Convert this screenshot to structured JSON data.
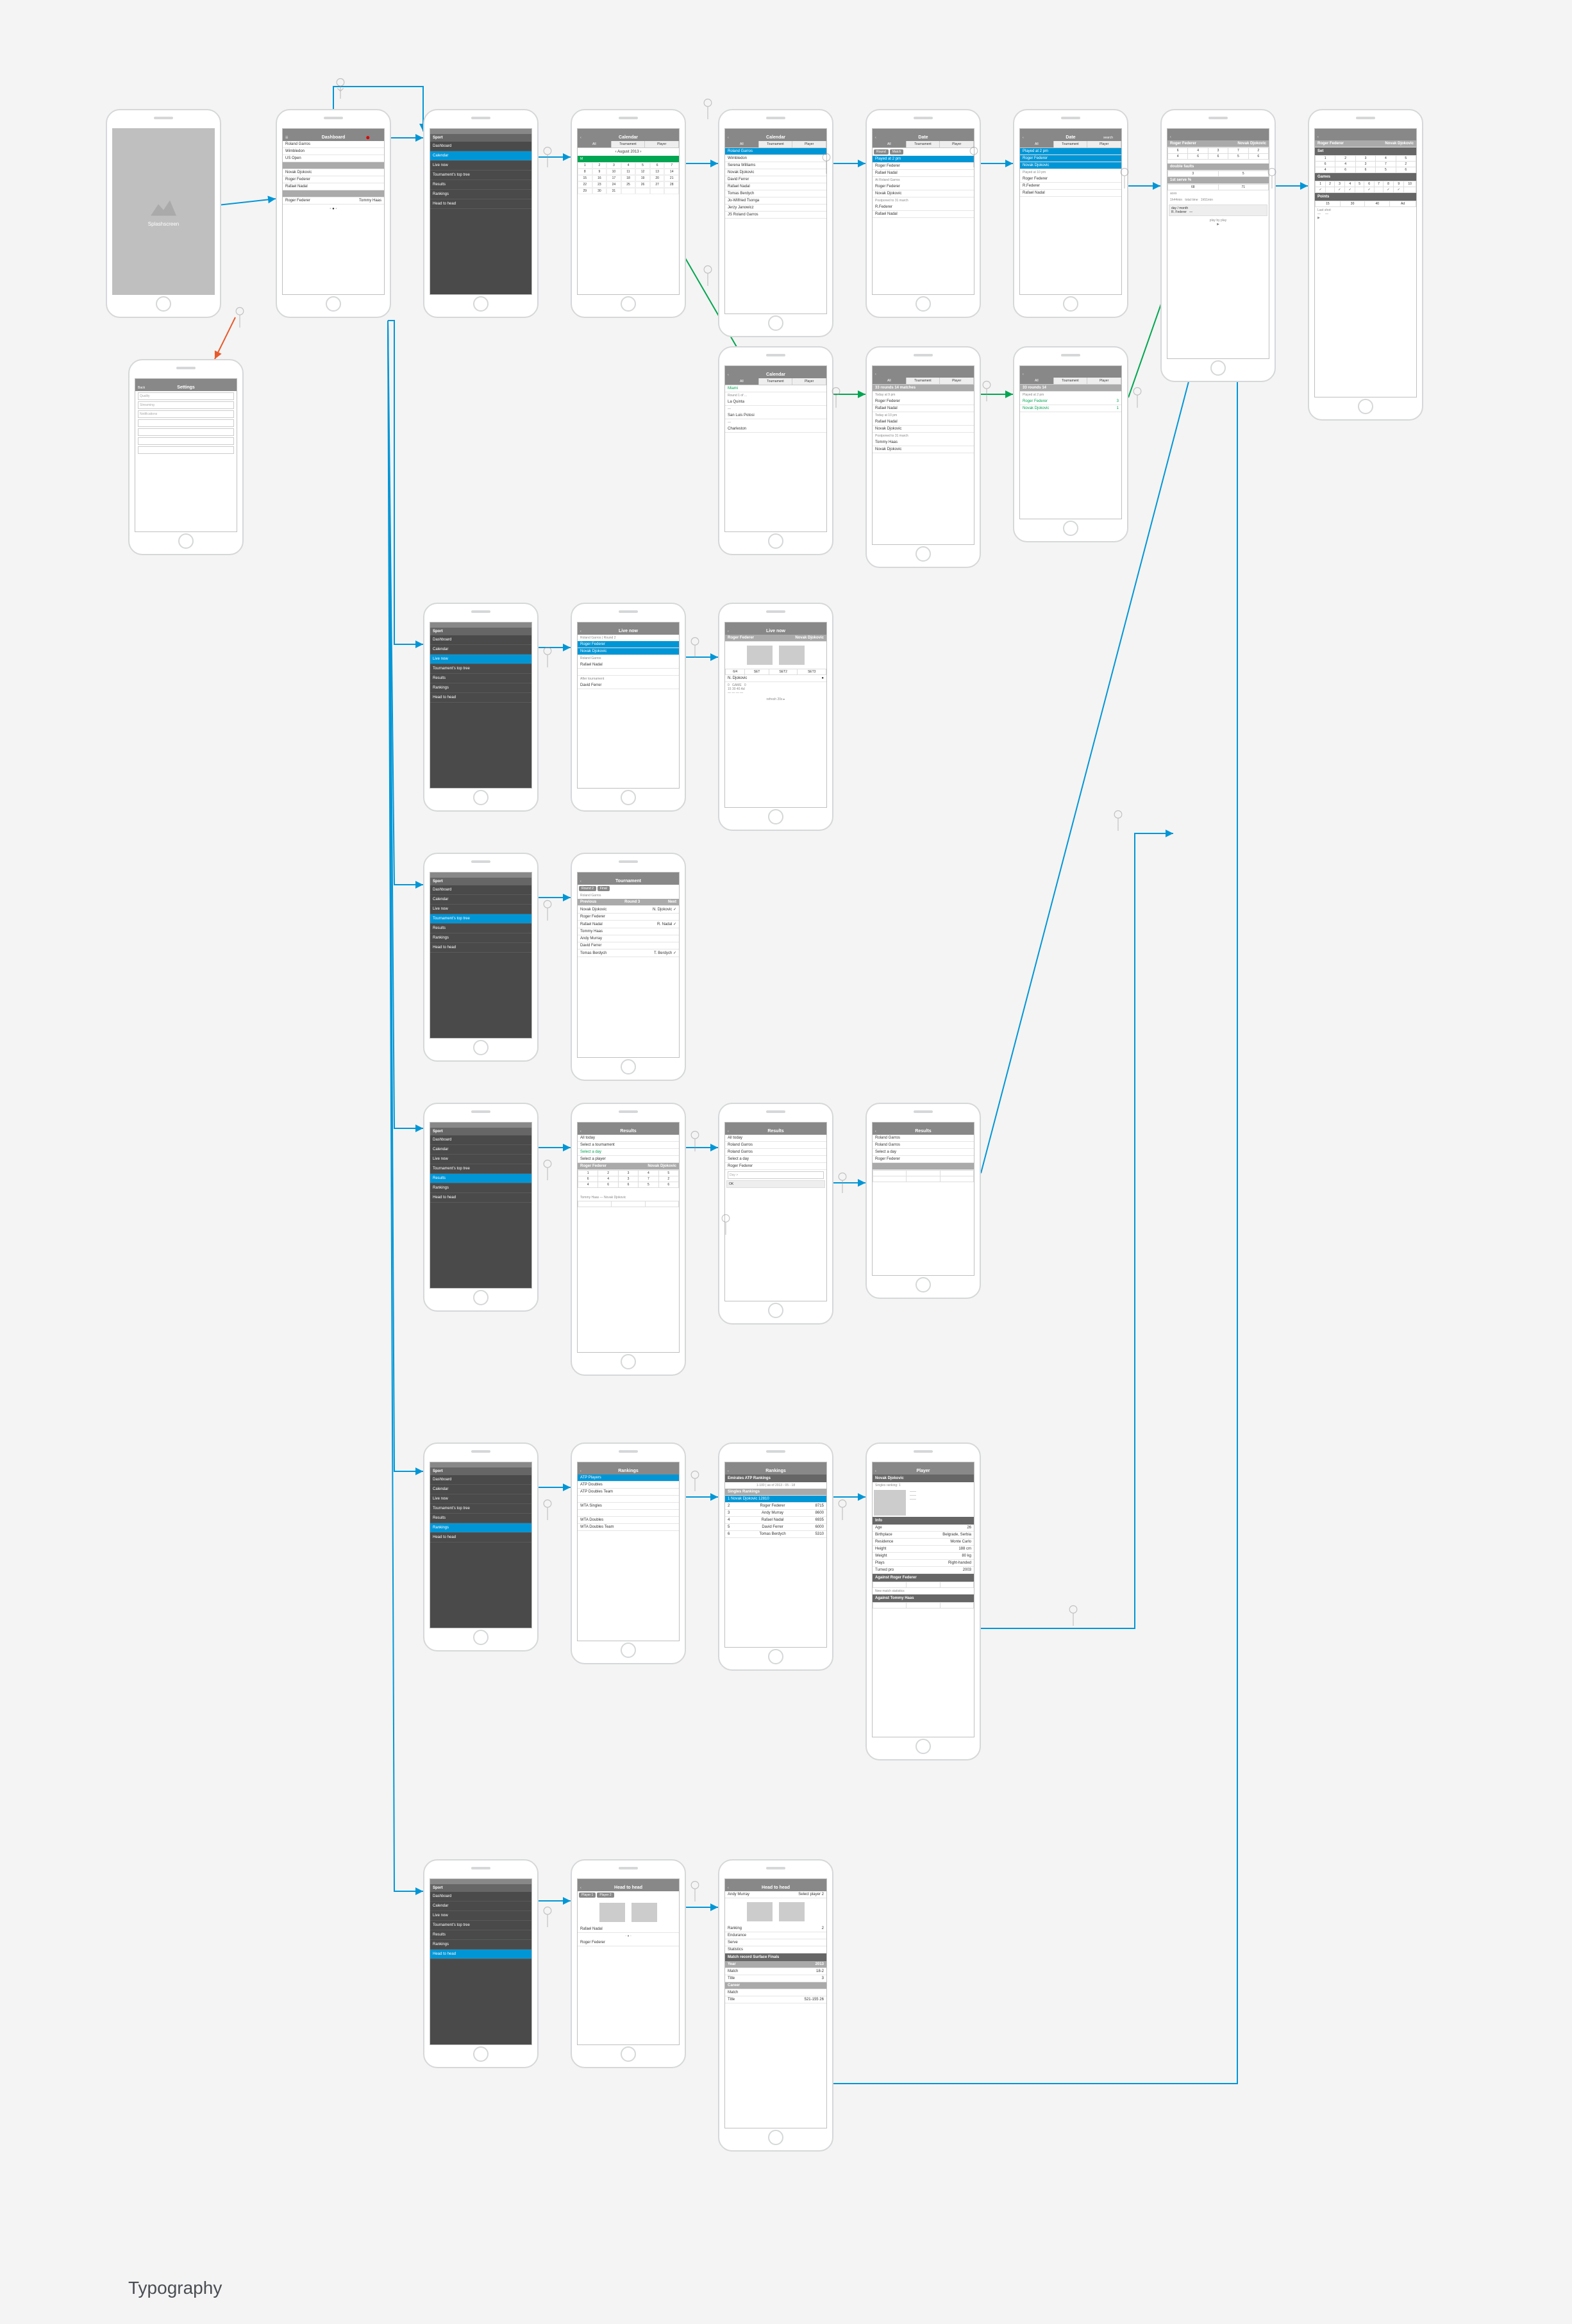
{
  "footer": "Typography",
  "screens": {
    "splash": {
      "label": "Splashscreen"
    },
    "dashboard": {
      "title": "Dashboard",
      "items": [
        "Roland Garros",
        "Wimbledon",
        "US Open",
        "",
        "Novak Djokovic",
        "Roger Federer",
        "Rafael Nadal"
      ],
      "foot": [
        "Roger Federer",
        "Tommy Haas"
      ]
    },
    "settings": {
      "title": "Settings",
      "back": "Back",
      "fields": [
        "Quality",
        "Streaming",
        "Notifications",
        "",
        "",
        "",
        "",
        ""
      ]
    },
    "menu1": {
      "title": "Sport",
      "items": [
        "Dashboard",
        "Calendar",
        "Live now",
        "Tournament's top tree",
        "Results",
        "Rankings",
        "Head to head"
      ],
      "sel": 1
    },
    "calendar": {
      "title": "Calendar",
      "tabs": [
        "All",
        "Tournament",
        "Player"
      ],
      "month": "August 2013",
      "days": [
        "M",
        "T",
        "W",
        "T",
        "F",
        "S",
        "S"
      ]
    },
    "calendar2": {
      "title": "Calendar",
      "tabs": [
        "All",
        "Tournament",
        "Player"
      ],
      "hl": "Roland Garros",
      "items": [
        "Wimbledon",
        "Serena Williams",
        "Novak Djokovic",
        "David Ferrer",
        "Rafael Nadal",
        "Tomas Berdych",
        "Jo-Wilfried Tsonga",
        "Jerzy Janowicz",
        "JS Roland Garros"
      ]
    },
    "calendar3": {
      "title": "Date",
      "tabs": [
        "All",
        "Tournament",
        "Player"
      ],
      "btns": [
        "Round",
        "Match"
      ],
      "sec": "Played at 2 pm",
      "p": [
        "Roger Federer",
        "Rafael Nadal"
      ],
      "sec2": "At Roland Garros",
      "p2": [
        "Roger Federer",
        "Novak Djokovic"
      ],
      "sec3": "Postponed to 31 march",
      "p3": [
        "R.Federer",
        "Rafael Nadal"
      ]
    },
    "calendar4": {
      "title": "Date",
      "searchlabel": "search",
      "tabs": [
        "All",
        "Tournament",
        "Player"
      ],
      "items": [
        "Played at 2 pm",
        "Roger Federer",
        "Novak Djokovic",
        "Played at 10 pm",
        "Roger Federer",
        "R.Federer",
        "Rafael Nadal"
      ]
    },
    "match1": {
      "names": [
        "Roger Federer",
        "Novak Djokovic"
      ],
      "stats": [
        "double faults",
        "1st serve %",
        "aces"
      ]
    },
    "match2": {
      "names": [
        "Roger Federer",
        "Novak Djokovic"
      ],
      "sections": [
        "Set",
        "Games",
        "Points"
      ]
    },
    "calendarB": {
      "title": "Calendar",
      "tabs": [
        "All",
        "Tournament",
        "Player"
      ],
      "items": [
        "Miami",
        "La Quinta",
        "",
        "San Luis Potosi",
        "",
        "Charleston",
        ""
      ]
    },
    "calendarB2": {
      "tabs": [
        "All",
        "Tournament",
        "Player"
      ],
      "sec": "33 rounds    14 matches",
      "items": [
        "Today at 9 pm",
        "Roger Federer",
        "Rafael Nadal",
        "",
        "Today at 10 pm",
        "Rafael Nadal",
        "Novak Djokovic",
        "",
        "Postponed to 31 march",
        "Tommy Haas",
        "Novak Djokovic"
      ]
    },
    "calendarB3": {
      "tabs": [
        "All",
        "Tournament",
        "Player"
      ],
      "sec": "33 rounds    14",
      "items": [
        "Played at 2 pm",
        "Roger Federer",
        "Novak Djokovic"
      ]
    },
    "menuLive": {
      "sel": 2
    },
    "livenow": {
      "title": "Live now",
      "sub": "Roland Garros  |  Round 2",
      "hl": [
        "Roger Federer",
        "Novak Djokovic"
      ],
      "items": [
        "Roland Garros",
        "Rafael Nadal",
        "",
        "After tournament",
        "David Ferrer"
      ]
    },
    "livenow2": {
      "title": "Live now",
      "names": [
        "Roger Federer",
        "Novak Djokovic"
      ],
      "scores": [
        "6/4",
        "SET",
        "SET2",
        "SET3"
      ],
      "serve": "N. Djokovic"
    },
    "menuTree": {
      "sel": 3
    },
    "tournament": {
      "title": "Tournament",
      "chips": [
        "Round 2",
        "Final"
      ],
      "sub": "Roland Garros",
      "rows": [
        [
          "Previous",
          "Round 3",
          "Next"
        ],
        [
          "Novak Djokovic",
          "N. Djokovic ✓"
        ],
        [
          "Roger Federer",
          ""
        ],
        [
          "Rafael Nadal",
          "R. Nadal ✓"
        ],
        [
          "Tommy Haas",
          ""
        ],
        [
          "Andy Murray",
          ""
        ],
        [
          "David Ferrer",
          ""
        ],
        [
          "Tomas Berdych",
          "T. Berdych ✓"
        ]
      ]
    },
    "menuResults": {
      "sel": 4
    },
    "results": {
      "title": "Results",
      "items": [
        "All today",
        "Select a tournament",
        "Select a day",
        "Select a player"
      ],
      "hl": "Roger Federer",
      "sub": "Novak Djokovic"
    },
    "results2": {
      "title": "Results",
      "items": [
        "All today",
        "Roland Garros",
        "Roland Garros",
        "Select a day",
        "Roger Federer"
      ],
      "day": "Day >"
    },
    "results3": {
      "title": "Results",
      "items": [
        "Roland Garros",
        "Roland Garros",
        "Select a day",
        "Roger Federer"
      ]
    },
    "menuRank": {
      "sel": 5
    },
    "rankings": {
      "title": "Rankings",
      "hl": "ATP Players",
      "items": [
        "ATP Doubles",
        "ATP Doubles Team",
        "",
        "WTA Singles",
        "",
        "WTA Doubles",
        "WTA Doubles Team"
      ]
    },
    "rankings2": {
      "title": "Rankings",
      "sub": "Emirates ATP Rankings",
      "date": "1-100 | as of 2013 - 05 - 18",
      "hl": "1   Novak Djokovic   12810",
      "rows": [
        [
          "2",
          "Roger Federer",
          "8715"
        ],
        [
          "3",
          "Andy Murray",
          "8600"
        ],
        [
          "4",
          "Rafael Nadal",
          "6935"
        ],
        [
          "5",
          "David Ferrer",
          "6000"
        ],
        [
          "6",
          "Tomas Berdych",
          "5310"
        ]
      ]
    },
    "player": {
      "title": "Player",
      "name": "Novak Djokovic",
      "rank": "Singles ranking: 1",
      "bio": [
        [
          "Age",
          "26"
        ],
        [
          "Birthplace",
          "Belgrade, Serbia"
        ],
        [
          "Residence",
          "Monte Carlo"
        ],
        [
          "Height",
          "188 cm"
        ],
        [
          "Weight",
          "80 kg"
        ],
        [
          "Plays",
          "Right-handed"
        ],
        [
          "Turned pro",
          "2003"
        ]
      ],
      "sec": "Against Roger Federer",
      "sec2": "New match statistics",
      "sec3": "Against Tommy Haas"
    },
    "menuH2H": {
      "sel": 6
    },
    "h2h": {
      "title": "Head to head",
      "p": [
        "Player 1",
        "Player 2"
      ],
      "rows": [
        "Rafael Nadal",
        "Roger Federer"
      ]
    },
    "h2h2": {
      "title": "Head to head",
      "sub": "Andy Murray",
      "sub2": "Select player 2",
      "stats": [
        [
          "Ranking",
          "2"
        ],
        [
          "Endurance",
          ""
        ],
        [
          "Serve",
          ""
        ],
        [
          "Statistics",
          ""
        ]
      ],
      "rec": "Match record   Surface   Finals",
      "tab": [
        [
          "2013",
          ""
        ],
        [
          "Match",
          "18-2"
        ],
        [
          "Title",
          "3"
        ],
        [
          "",
          "Career"
        ],
        [
          "Match",
          ""
        ],
        [
          "Title",
          "521-155  26"
        ]
      ]
    }
  }
}
